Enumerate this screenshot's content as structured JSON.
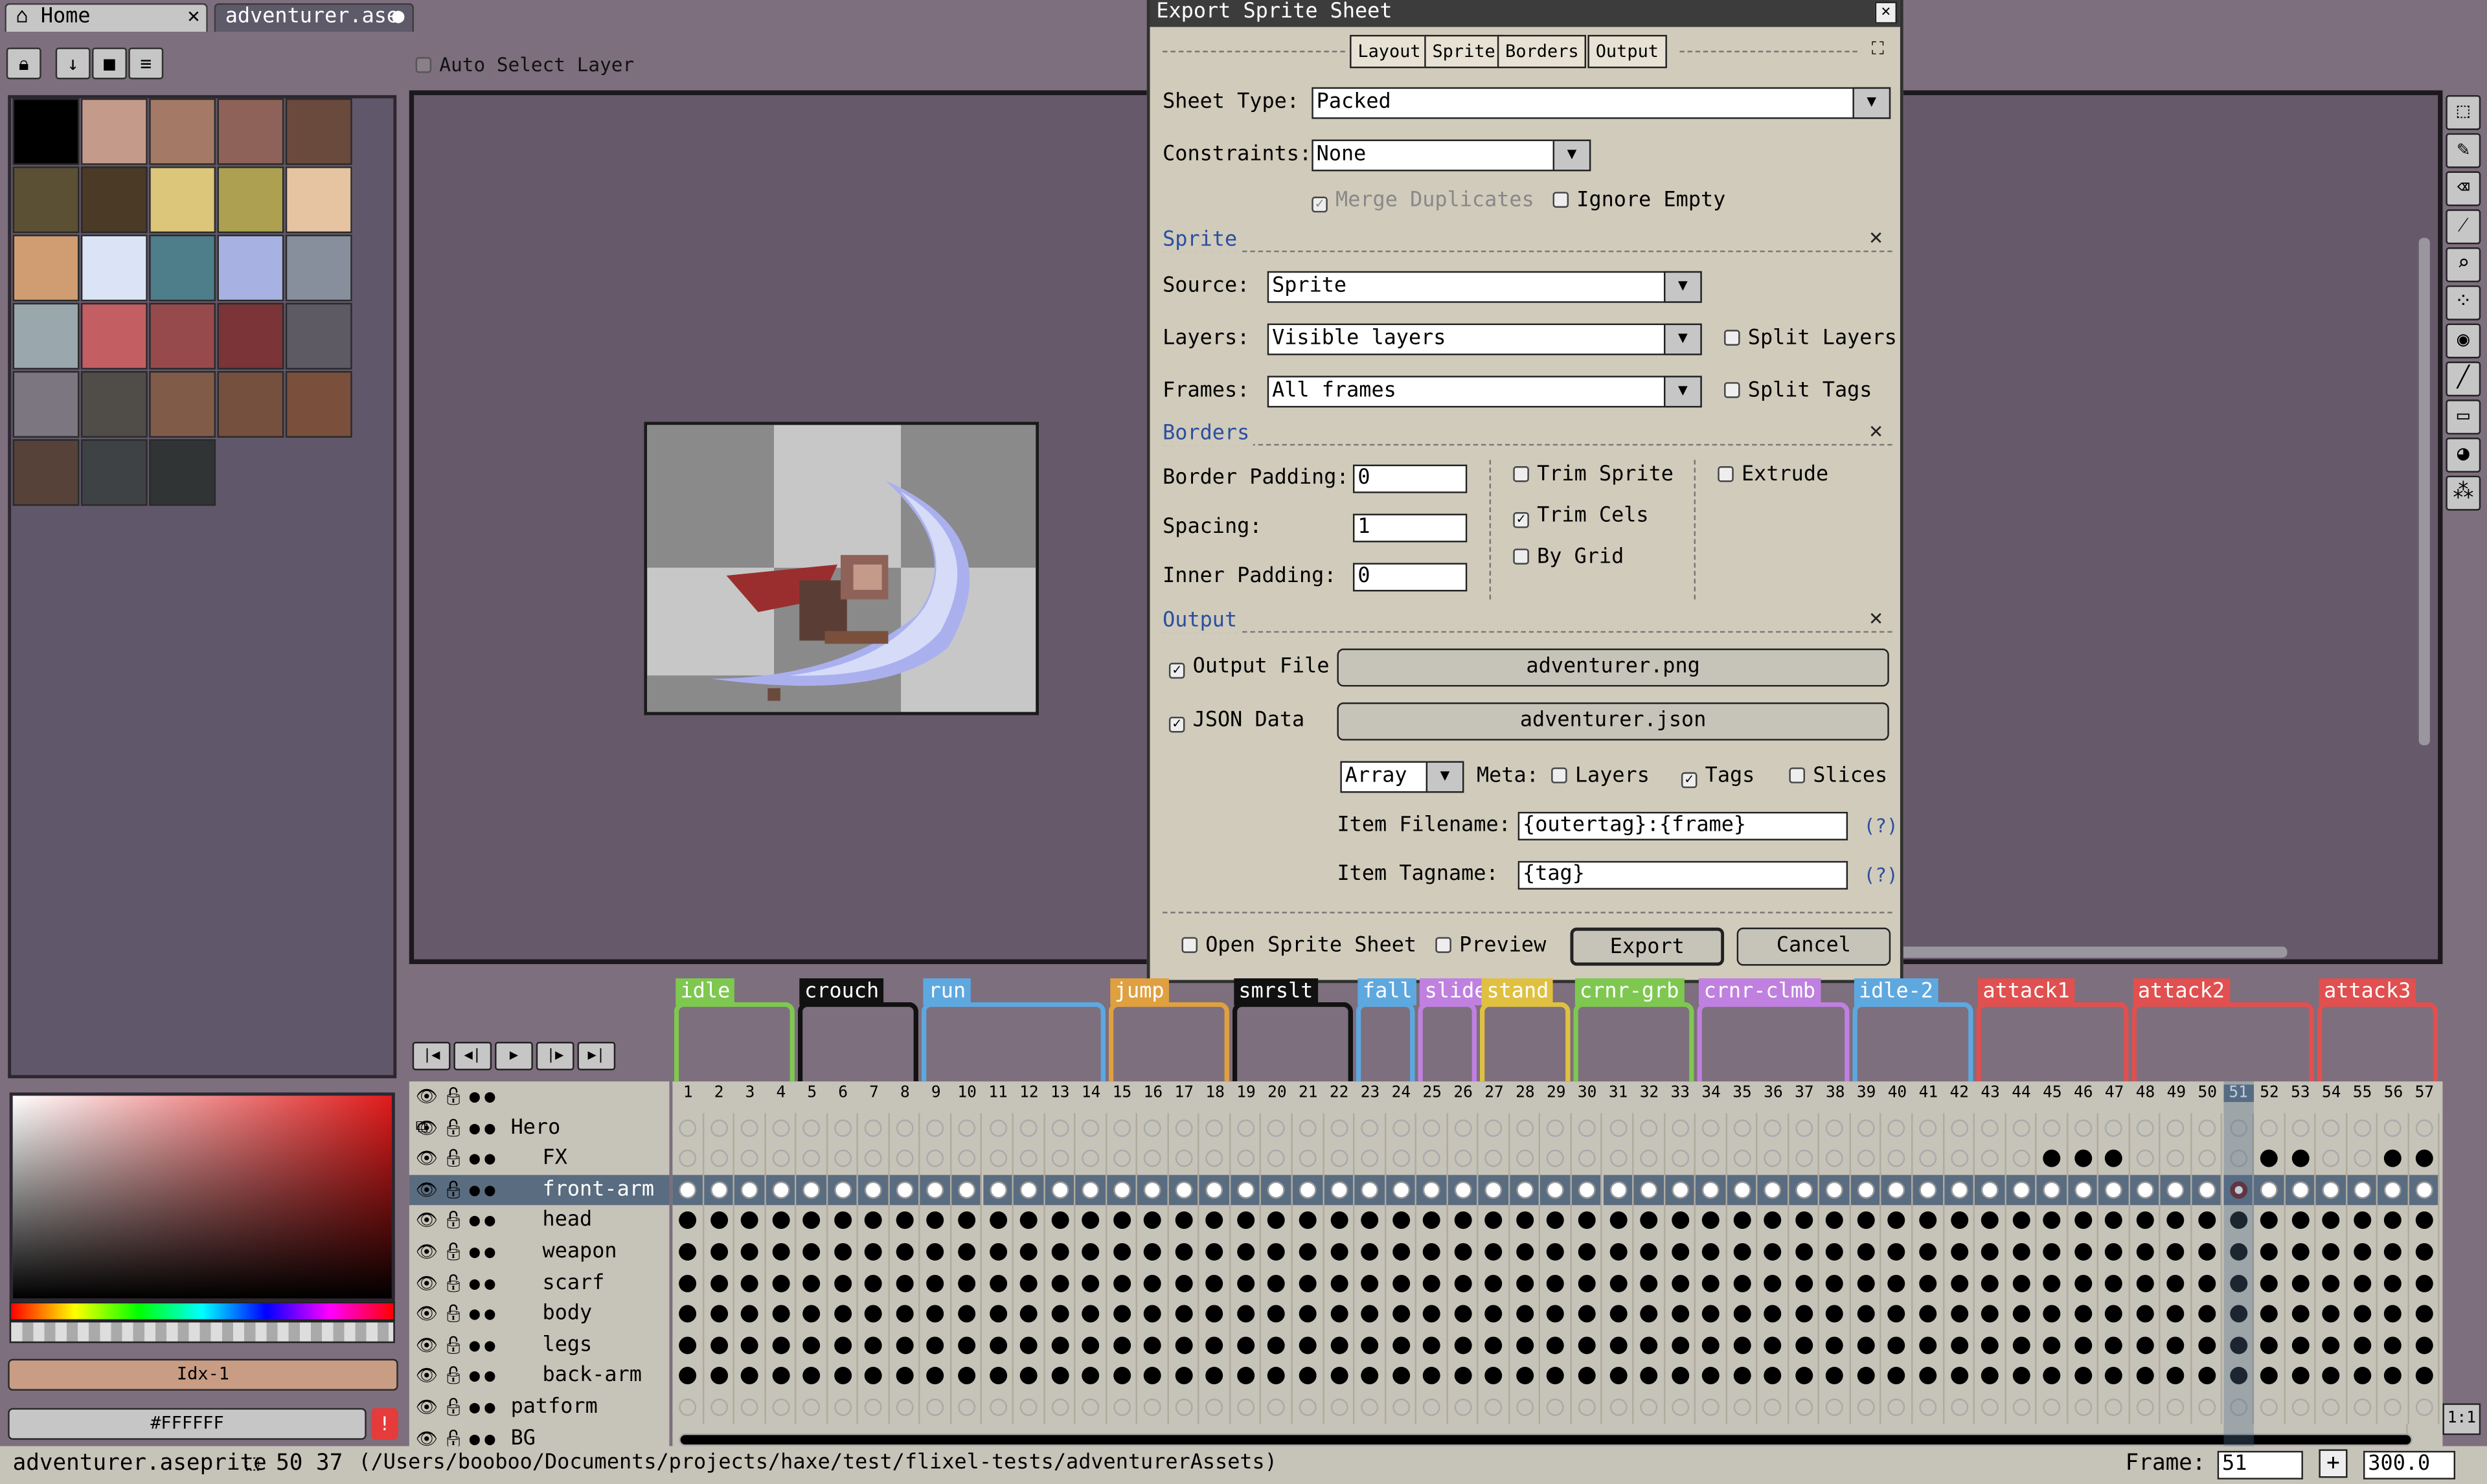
{
  "tabs": [
    {
      "label": "Home"
    },
    {
      "label": "adventurer.ase"
    }
  ],
  "toolbar": {
    "auto_select_label": "Auto Select Layer"
  },
  "palette": {
    "colors": [
      "#000000",
      "#c49a8b",
      "#a47a66",
      "#8e6258",
      "#6b4a3e",
      "#5b5033",
      "#4a3a26",
      "#dcc67a",
      "#ada050",
      "#e6c4a2",
      "#d09c72",
      "#dbe3f6",
      "#4e7e8a",
      "#a7b2e2",
      "#868f9b",
      "#9aa7ad",
      "#c35e62",
      "#974a4c",
      "#7b3438",
      "#5e5a63",
      "#7c7680",
      "#504c48",
      "#805c48",
      "#76503e",
      "#7a503c",
      "#564238",
      "#3e4244",
      "#303434"
    ]
  },
  "color_bar": {
    "index_label": "Idx-1",
    "hex_label": "#FFFFFF"
  },
  "dialog": {
    "title": "Export Sprite Sheet",
    "tabs": [
      "Layout",
      "Sprite",
      "Borders",
      "Output"
    ],
    "layout": {
      "sheet_type_label": "Sheet Type:",
      "sheet_type_value": "Packed",
      "constraints_label": "Constraints:",
      "constraints_value": "None",
      "merge_duplicates": "Merge Duplicates",
      "ignore_empty": "Ignore Empty"
    },
    "sprite": {
      "section": "Sprite",
      "source_label": "Source:",
      "source_value": "Sprite",
      "layers_label": "Layers:",
      "layers_value": "Visible layers",
      "frames_label": "Frames:",
      "frames_value": "All frames",
      "split_layers": "Split Layers",
      "split_tags": "Split Tags"
    },
    "borders": {
      "section": "Borders",
      "border_padding_label": "Border Padding:",
      "border_padding_value": "0",
      "spacing_label": "Spacing:",
      "spacing_value": "1",
      "inner_padding_label": "Inner Padding:",
      "inner_padding_value": "0",
      "trim_sprite": "Trim Sprite",
      "trim_cels": "Trim Cels",
      "by_grid": "By Grid",
      "extrude": "Extrude"
    },
    "output": {
      "section": "Output",
      "output_file_label": "Output File",
      "output_file_value": "adventurer.png",
      "json_label": "JSON Data",
      "json_value": "adventurer.json",
      "format_value": "Array",
      "meta_label": "Meta:",
      "meta_layers": "Layers",
      "meta_tags": "Tags",
      "meta_slices": "Slices",
      "item_filename_label": "Item Filename:",
      "item_filename_value": "{outertag}:{frame}",
      "item_tagname_label": "Item Tagname:",
      "item_tagname_value": "{tag}",
      "help": "(?)"
    },
    "open_sheet": "Open Sprite Sheet",
    "preview": "Preview",
    "export_button": "Export",
    "cancel_button": "Cancel"
  },
  "timeline": {
    "tags": [
      {
        "name": "idle",
        "color": "#7ec850",
        "start": 1,
        "end": 4
      },
      {
        "name": "crouch",
        "color": "#111111",
        "start": 5,
        "end": 8
      },
      {
        "name": "run",
        "color": "#5ea8e0",
        "start": 9,
        "end": 14
      },
      {
        "name": "jump",
        "color": "#e0a040",
        "start": 15,
        "end": 18
      },
      {
        "name": "smrslt",
        "color": "#111111",
        "start": 19,
        "end": 22
      },
      {
        "name": "fall",
        "color": "#5ea8e0",
        "start": 23,
        "end": 24
      },
      {
        "name": "slide",
        "color": "#c080e0",
        "start": 25,
        "end": 26
      },
      {
        "name": "stand",
        "color": "#e0c040",
        "start": 27,
        "end": 29
      },
      {
        "name": "crnr-grb",
        "color": "#7ec850",
        "start": 30,
        "end": 33
      },
      {
        "name": "crnr-clmb",
        "color": "#c080e0",
        "start": 34,
        "end": 38
      },
      {
        "name": "idle-2",
        "color": "#5ea8e0",
        "start": 39,
        "end": 42
      },
      {
        "name": "attack1",
        "color": "#e05050",
        "start": 43,
        "end": 47
      },
      {
        "name": "attack2",
        "color": "#e05050",
        "start": 48,
        "end": 53
      },
      {
        "name": "attack3",
        "color": "#e05050",
        "start": 54,
        "end": 57
      }
    ],
    "frame_count": 57,
    "current_frame": 51,
    "layers": [
      {
        "name": "Hero",
        "indent": 0,
        "kind": "group"
      },
      {
        "name": "FX",
        "indent": 1,
        "kind": "fx"
      },
      {
        "name": "front-arm",
        "indent": 1,
        "kind": "white"
      },
      {
        "name": "head",
        "indent": 1,
        "kind": "full"
      },
      {
        "name": "weapon",
        "indent": 1,
        "kind": "full"
      },
      {
        "name": "scarf",
        "indent": 1,
        "kind": "full"
      },
      {
        "name": "body",
        "indent": 1,
        "kind": "full"
      },
      {
        "name": "legs",
        "indent": 1,
        "kind": "full"
      },
      {
        "name": "back-arm",
        "indent": 1,
        "kind": "full"
      },
      {
        "name": "patform",
        "indent": 0,
        "kind": "empty"
      },
      {
        "name": "BG",
        "indent": 0,
        "kind": "line"
      }
    ]
  },
  "status": {
    "filename": "adventurer.aseprite",
    "coords": "50 37",
    "path": "(/Users/booboo/Documents/projects/haxe/test/flixel-tests/adventurerAssets)",
    "frame_label": "Frame:",
    "frame_value": "51",
    "zoom_value": "300.0"
  }
}
